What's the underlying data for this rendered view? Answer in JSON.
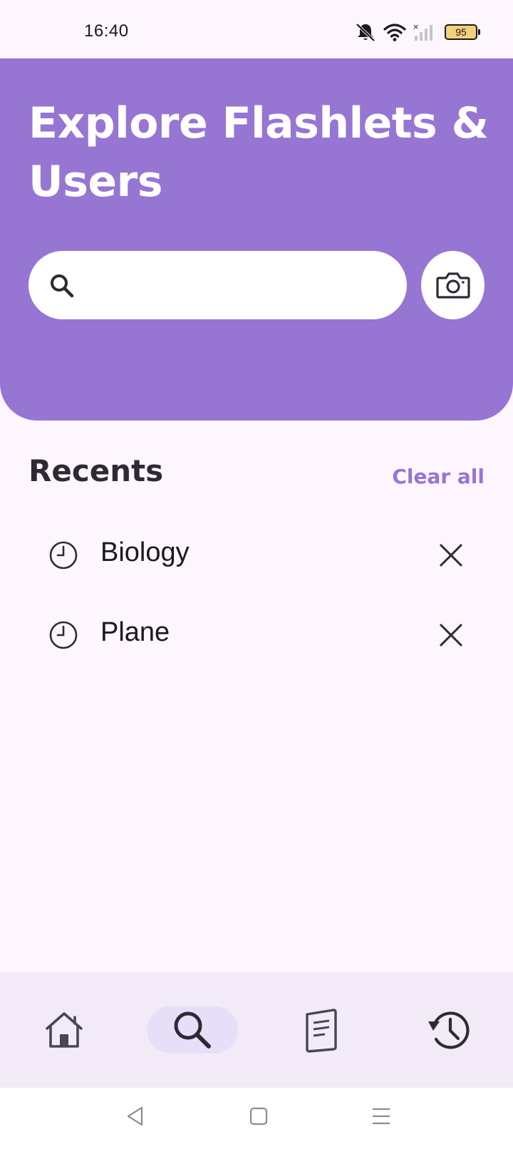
{
  "status_bar": {
    "time": "16:40",
    "battery": "95",
    "icons": [
      "bell-muted-icon",
      "wifi-icon",
      "signal-icon",
      "battery-icon"
    ]
  },
  "header": {
    "title": "Explore Flashlets & Users",
    "background_color": "#9775d3",
    "search": {
      "value": "",
      "placeholder": "",
      "icon": "search-icon"
    },
    "camera_icon": "camera-icon"
  },
  "recents": {
    "title": "Recents",
    "clear_label": "Clear all",
    "items": [
      {
        "label": "Biology",
        "icon": "clock-icon",
        "remove_icon": "close-icon"
      },
      {
        "label": "Plane",
        "icon": "clock-icon",
        "remove_icon": "close-icon"
      }
    ]
  },
  "bottom_nav": {
    "items": [
      {
        "icon": "home-icon",
        "active": false
      },
      {
        "icon": "search-icon",
        "active": true
      },
      {
        "icon": "flashcards-icon",
        "active": false
      },
      {
        "icon": "history-icon",
        "active": false
      }
    ],
    "active_color": "#e7def7"
  },
  "system_nav": {
    "items": [
      "back-icon",
      "home-square-icon",
      "menu-icon"
    ]
  }
}
